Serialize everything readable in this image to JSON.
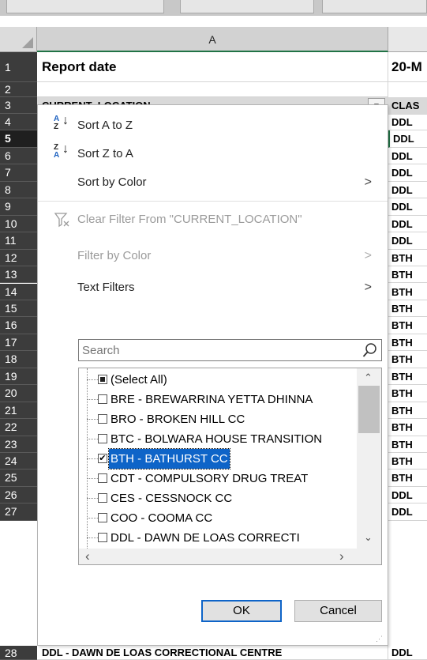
{
  "column_header": "A",
  "rows": [
    "1",
    "2",
    "3",
    "4",
    "5",
    "6",
    "7",
    "8",
    "9",
    "10",
    "11",
    "12",
    "13",
    "14",
    "15",
    "16",
    "17",
    "18",
    "19",
    "20",
    "21",
    "22",
    "23",
    "24",
    "25",
    "26",
    "27",
    "28"
  ],
  "selected_row": "5",
  "cells": {
    "a1": "Report date",
    "b1": "20-M",
    "a3": "CURRENT_LOCATION",
    "b3": "CLAS",
    "a28": "DDL - DAWN DE LOAS CORRECTIONAL CENTRE"
  },
  "column_b_values": [
    "DDL",
    "DDL",
    "DDL",
    "DDL",
    "DDL",
    "DDL",
    "DDL",
    "DDL",
    "BTH",
    "BTH",
    "BTH",
    "BTH",
    "BTH",
    "BTH",
    "BTH",
    "BTH",
    "BTH",
    "BTH",
    "BTH",
    "BTH",
    "BTH",
    "BTH",
    "DDL",
    "DDL",
    "DDL"
  ],
  "filter_menu": {
    "sort_az": "Sort A to Z",
    "sort_za": "Sort Z to A",
    "sort_by_color": "Sort by Color",
    "clear_filter": "Clear Filter From \"CURRENT_LOCATION\"",
    "filter_by_color": "Filter by Color",
    "text_filters": "Text Filters",
    "search_placeholder": "Search",
    "items": [
      {
        "label": "(Select All)",
        "state": "partial"
      },
      {
        "label": "BRE - BREWARRINA YETTA DHINNA",
        "state": "unchecked"
      },
      {
        "label": "BRO - BROKEN HILL CC",
        "state": "unchecked"
      },
      {
        "label": "BTC - BOLWARA HOUSE TRANSITION",
        "state": "unchecked"
      },
      {
        "label": "BTH - BATHURST CC",
        "state": "checked"
      },
      {
        "label": "CDT - COMPULSORY DRUG TREAT",
        "state": "unchecked"
      },
      {
        "label": "CES - CESSNOCK CC",
        "state": "unchecked"
      },
      {
        "label": "COO - COOMA CC",
        "state": "unchecked"
      },
      {
        "label": "DDL - DAWN DE LOAS CORRECTI",
        "state": "unchecked"
      }
    ],
    "ok_label": "OK",
    "cancel_label": "Cancel",
    "arrow_glyph": ">"
  }
}
